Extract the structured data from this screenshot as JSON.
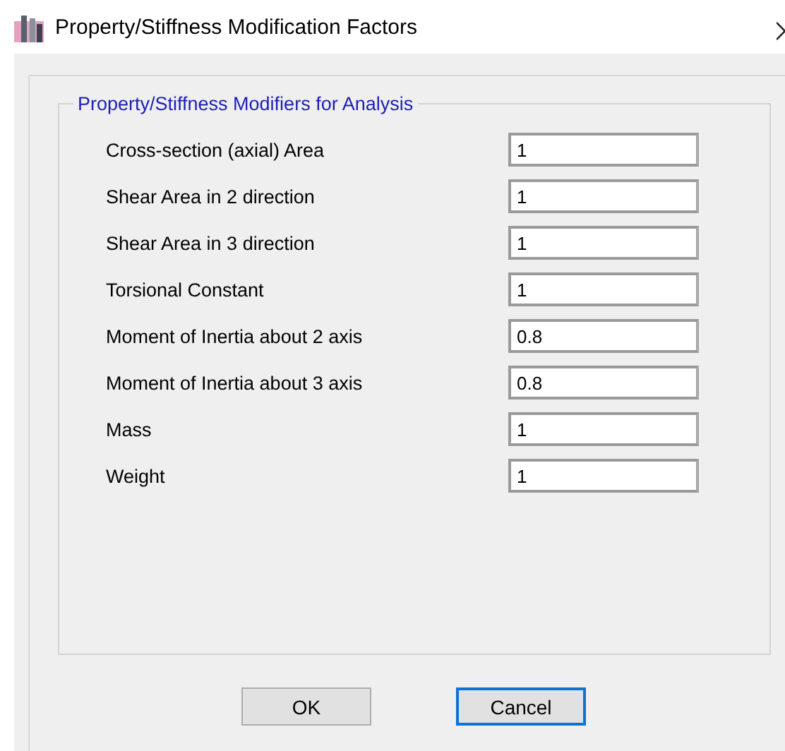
{
  "window": {
    "title": "Property/Stiffness Modification Factors"
  },
  "group": {
    "title": "Property/Stiffness Modifiers for Analysis",
    "fields": [
      {
        "label": "Cross-section (axial) Area",
        "value": "1"
      },
      {
        "label": "Shear Area in 2 direction",
        "value": "1"
      },
      {
        "label": "Shear Area in 3 direction",
        "value": "1"
      },
      {
        "label": "Torsional Constant",
        "value": "1"
      },
      {
        "label": "Moment of Inertia about 2 axis",
        "value": "0.8"
      },
      {
        "label": "Moment of Inertia about 3 axis",
        "value": "0.8"
      },
      {
        "label": "Mass",
        "value": "1"
      },
      {
        "label": "Weight",
        "value": "1"
      }
    ]
  },
  "buttons": [
    {
      "label": "OK",
      "focused": false
    },
    {
      "label": "Cancel",
      "focused": true
    }
  ]
}
